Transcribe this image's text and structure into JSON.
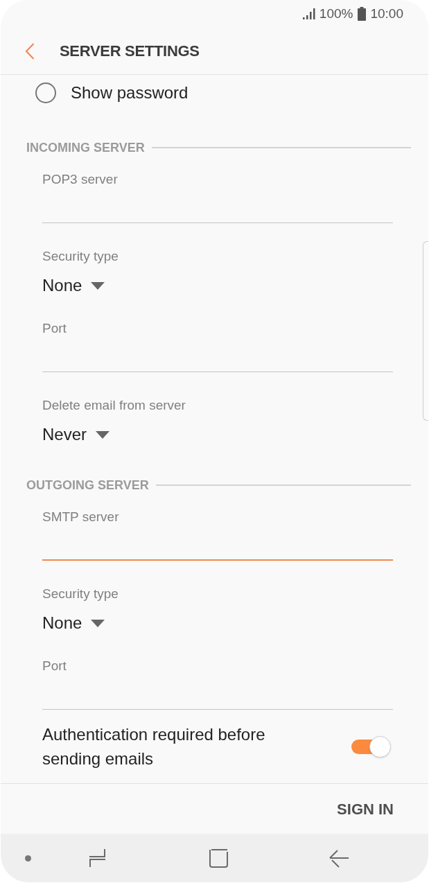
{
  "status_bar": {
    "battery": "100%",
    "time": "10:00"
  },
  "header": {
    "title": "SERVER SETTINGS"
  },
  "show_password": {
    "label": "Show password",
    "checked": false
  },
  "sections": [
    {
      "title": "INCOMING SERVER",
      "fields": [
        {
          "kind": "text",
          "label": "POP3 server",
          "focused": false
        },
        {
          "kind": "dropdown",
          "label": "Security type",
          "value": "None"
        },
        {
          "kind": "text",
          "label": "Port",
          "focused": false
        },
        {
          "kind": "dropdown",
          "label": "Delete email from server",
          "value": "Never"
        }
      ]
    },
    {
      "title": "OUTGOING SERVER",
      "fields": [
        {
          "kind": "text",
          "label": "SMTP server",
          "focused": true
        },
        {
          "kind": "dropdown",
          "label": "Security type",
          "value": "None"
        },
        {
          "kind": "text",
          "label": "Port",
          "focused": false
        },
        {
          "kind": "switch",
          "label": "Authentication required before sending emails",
          "on": true
        }
      ]
    }
  ],
  "footer": {
    "button": "SIGN IN"
  }
}
